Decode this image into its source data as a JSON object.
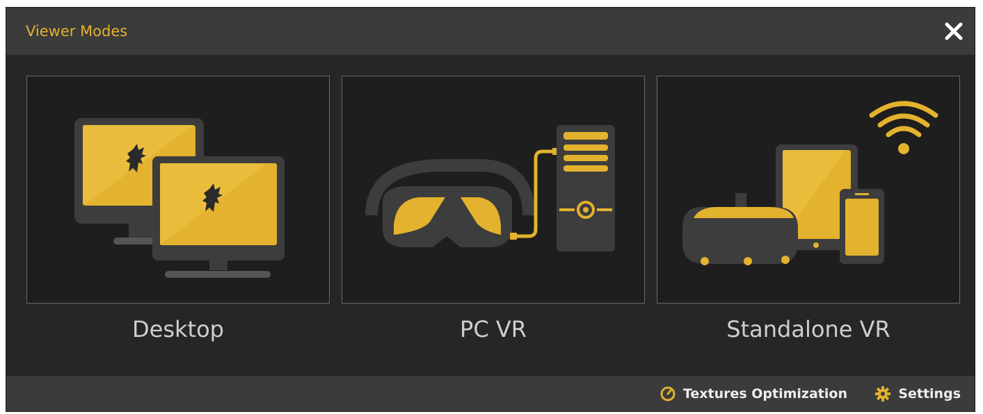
{
  "window": {
    "title": "Viewer Modes"
  },
  "modes": [
    {
      "label": "Desktop",
      "icon": "dual-monitor-icon"
    },
    {
      "label": "PC VR",
      "icon": "vr-headset-pc-icon"
    },
    {
      "label": "Standalone VR",
      "icon": "standalone-vr-devices-icon"
    }
  ],
  "footer": {
    "textures_label": "Textures Optimization",
    "settings_label": "Settings"
  },
  "colors": {
    "accent": "#e3b22e",
    "panel": "#262626",
    "bar": "#3b3b3b",
    "device": "#3d3d3d"
  }
}
